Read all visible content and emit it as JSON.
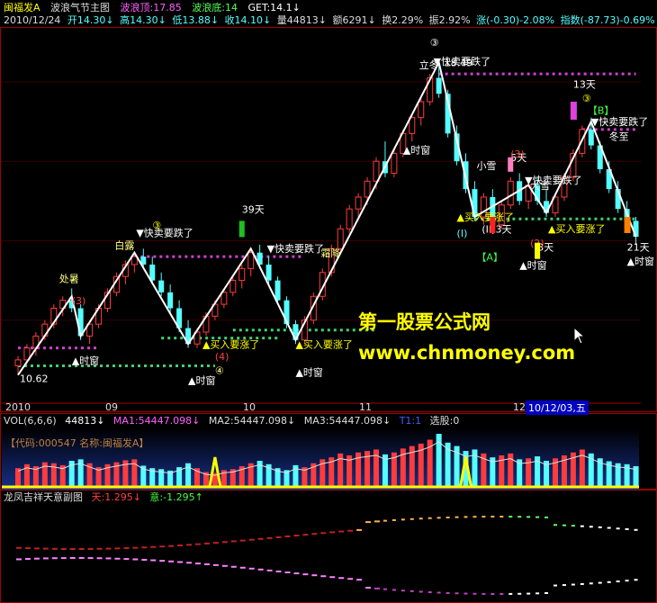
{
  "header": {
    "stock_name": "闽福发A",
    "indicator_name": "波浪气节主图",
    "wave_top_label": "波浪顶:",
    "wave_top_value": "17.85",
    "wave_bottom_label": "波浪底:",
    "wave_bottom_value": "14",
    "get_label": "GET:",
    "get_value": "14.1↓"
  },
  "quote": {
    "date": "2010/12/24",
    "open": "开14.30↓",
    "high": "高14.30↓",
    "low": "低13.88↓",
    "close": "收14.10↓",
    "volume": "量44813↓",
    "amount": "额6291↓",
    "turnover": "换2.29%",
    "amplitude": "振2.92%",
    "change": "涨(-0.30)-2.08%",
    "index": "指数(-87.73)-0.69%"
  },
  "colors": {
    "up": "#ff3c3c",
    "down": "#54ffff",
    "wave": "#ffffff",
    "magenta_dot": "#d040d0",
    "green_dot": "#40d070",
    "yellow": "#ffff00",
    "frame": "#a00000",
    "watermark": "#ffff00"
  },
  "watermark": {
    "title": "第一股票公式网",
    "url": "www.chnmoney.com"
  },
  "x_labels": [
    "2010",
    "09",
    "10",
    "11",
    "12"
  ],
  "date_cursor": "10/12/03,五",
  "chart_data": {
    "type": "candlestick",
    "ylim": [
      10.0,
      19.2
    ],
    "price_high": 18.49,
    "price_low": 10.62,
    "candles": [
      {
        "o": 10.85,
        "h": 11.1,
        "l": 10.62,
        "c": 11.0
      },
      {
        "o": 11.0,
        "h": 11.4,
        "l": 10.9,
        "c": 11.3
      },
      {
        "o": 11.3,
        "h": 11.7,
        "l": 11.1,
        "c": 11.6
      },
      {
        "o": 11.6,
        "h": 12.0,
        "l": 11.5,
        "c": 11.9
      },
      {
        "o": 11.9,
        "h": 12.4,
        "l": 11.8,
        "c": 12.3
      },
      {
        "o": 12.3,
        "h": 12.6,
        "l": 12.1,
        "c": 12.5
      },
      {
        "o": 12.5,
        "h": 12.8,
        "l": 12.2,
        "c": 12.3
      },
      {
        "o": 12.3,
        "h": 12.4,
        "l": 11.5,
        "c": 11.6
      },
      {
        "o": 11.6,
        "h": 12.0,
        "l": 11.4,
        "c": 11.9
      },
      {
        "o": 11.9,
        "h": 12.4,
        "l": 11.8,
        "c": 12.3
      },
      {
        "o": 12.3,
        "h": 12.8,
        "l": 12.2,
        "c": 12.7
      },
      {
        "o": 12.7,
        "h": 13.2,
        "l": 12.6,
        "c": 13.1
      },
      {
        "o": 13.1,
        "h": 13.5,
        "l": 12.9,
        "c": 13.4
      },
      {
        "o": 13.4,
        "h": 13.7,
        "l": 13.2,
        "c": 13.6
      },
      {
        "o": 13.6,
        "h": 13.8,
        "l": 13.3,
        "c": 13.4
      },
      {
        "o": 13.4,
        "h": 13.6,
        "l": 12.9,
        "c": 13.0
      },
      {
        "o": 13.0,
        "h": 13.2,
        "l": 12.6,
        "c": 12.7
      },
      {
        "o": 12.7,
        "h": 12.9,
        "l": 12.2,
        "c": 12.3
      },
      {
        "o": 12.3,
        "h": 12.5,
        "l": 11.7,
        "c": 11.8
      },
      {
        "o": 11.8,
        "h": 12.0,
        "l": 11.3,
        "c": 11.4
      },
      {
        "o": 11.4,
        "h": 11.8,
        "l": 11.3,
        "c": 11.7
      },
      {
        "o": 11.7,
        "h": 12.2,
        "l": 11.6,
        "c": 12.1
      },
      {
        "o": 12.1,
        "h": 12.5,
        "l": 12.0,
        "c": 12.4
      },
      {
        "o": 12.4,
        "h": 12.8,
        "l": 12.3,
        "c": 12.7
      },
      {
        "o": 12.7,
        "h": 13.1,
        "l": 12.6,
        "c": 13.0
      },
      {
        "o": 13.0,
        "h": 13.4,
        "l": 12.8,
        "c": 13.3
      },
      {
        "o": 13.3,
        "h": 13.8,
        "l": 13.1,
        "c": 13.7
      },
      {
        "o": 13.7,
        "h": 13.9,
        "l": 13.3,
        "c": 13.4
      },
      {
        "o": 13.4,
        "h": 13.6,
        "l": 12.9,
        "c": 13.0
      },
      {
        "o": 13.0,
        "h": 13.1,
        "l": 12.4,
        "c": 12.5
      },
      {
        "o": 12.5,
        "h": 12.6,
        "l": 11.8,
        "c": 11.9
      },
      {
        "o": 11.9,
        "h": 12.0,
        "l": 11.4,
        "c": 11.5
      },
      {
        "o": 11.5,
        "h": 12.1,
        "l": 11.4,
        "c": 12.0
      },
      {
        "o": 12.0,
        "h": 12.7,
        "l": 11.9,
        "c": 12.6
      },
      {
        "o": 12.6,
        "h": 13.3,
        "l": 12.5,
        "c": 13.2
      },
      {
        "o": 13.2,
        "h": 13.9,
        "l": 13.1,
        "c": 13.8
      },
      {
        "o": 13.8,
        "h": 14.4,
        "l": 13.7,
        "c": 14.3
      },
      {
        "o": 14.3,
        "h": 14.9,
        "l": 14.2,
        "c": 14.8
      },
      {
        "o": 14.8,
        "h": 15.2,
        "l": 14.5,
        "c": 15.1
      },
      {
        "o": 15.1,
        "h": 15.6,
        "l": 14.9,
        "c": 15.5
      },
      {
        "o": 15.5,
        "h": 16.1,
        "l": 15.3,
        "c": 16.0
      },
      {
        "o": 16.0,
        "h": 16.5,
        "l": 15.6,
        "c": 15.7
      },
      {
        "o": 15.7,
        "h": 16.3,
        "l": 15.6,
        "c": 16.2
      },
      {
        "o": 16.2,
        "h": 16.8,
        "l": 16.1,
        "c": 16.7
      },
      {
        "o": 16.7,
        "h": 17.2,
        "l": 16.5,
        "c": 17.1
      },
      {
        "o": 17.1,
        "h": 17.6,
        "l": 16.9,
        "c": 17.5
      },
      {
        "o": 17.5,
        "h": 18.2,
        "l": 17.4,
        "c": 18.1
      },
      {
        "o": 18.1,
        "h": 18.49,
        "l": 17.6,
        "c": 17.7
      },
      {
        "o": 17.7,
        "h": 17.8,
        "l": 16.6,
        "c": 16.7
      },
      {
        "o": 16.7,
        "h": 16.9,
        "l": 15.9,
        "c": 16.0
      },
      {
        "o": 16.0,
        "h": 16.2,
        "l": 15.2,
        "c": 15.3
      },
      {
        "o": 15.3,
        "h": 15.5,
        "l": 14.5,
        "c": 14.6
      },
      {
        "o": 14.6,
        "h": 15.2,
        "l": 14.4,
        "c": 15.1
      },
      {
        "o": 15.1,
        "h": 15.3,
        "l": 14.3,
        "c": 14.4
      },
      {
        "o": 14.4,
        "h": 15.0,
        "l": 14.3,
        "c": 14.9
      },
      {
        "o": 14.9,
        "h": 15.6,
        "l": 14.8,
        "c": 15.5
      },
      {
        "o": 15.5,
        "h": 15.7,
        "l": 14.9,
        "c": 15.0
      },
      {
        "o": 15.0,
        "h": 15.5,
        "l": 14.8,
        "c": 15.4
      },
      {
        "o": 15.4,
        "h": 15.6,
        "l": 14.9,
        "c": 15.0
      },
      {
        "o": 15.0,
        "h": 15.3,
        "l": 14.6,
        "c": 14.7
      },
      {
        "o": 14.7,
        "h": 15.2,
        "l": 14.6,
        "c": 15.1
      },
      {
        "o": 15.1,
        "h": 15.7,
        "l": 15.0,
        "c": 15.6
      },
      {
        "o": 15.6,
        "h": 16.3,
        "l": 15.5,
        "c": 16.2
      },
      {
        "o": 16.2,
        "h": 16.9,
        "l": 16.1,
        "c": 16.8
      },
      {
        "o": 16.8,
        "h": 17.1,
        "l": 16.3,
        "c": 16.4
      },
      {
        "o": 16.4,
        "h": 16.5,
        "l": 15.7,
        "c": 15.8
      },
      {
        "o": 15.8,
        "h": 16.0,
        "l": 15.2,
        "c": 15.3
      },
      {
        "o": 15.3,
        "h": 15.5,
        "l": 14.7,
        "c": 14.8
      },
      {
        "o": 14.8,
        "h": 15.0,
        "l": 14.3,
        "c": 14.5
      },
      {
        "o": 14.5,
        "h": 14.6,
        "l": 13.9,
        "c": 14.1
      }
    ],
    "wave_line": [
      {
        "i": 0,
        "v": 10.62
      },
      {
        "i": 6,
        "v": 12.6
      },
      {
        "i": 7,
        "v": 11.6
      },
      {
        "i": 13,
        "v": 13.7
      },
      {
        "i": 19,
        "v": 11.4
      },
      {
        "i": 26,
        "v": 13.8
      },
      {
        "i": 31,
        "v": 11.5
      },
      {
        "i": 47,
        "v": 18.49
      },
      {
        "i": 51,
        "v": 14.6
      },
      {
        "i": 54,
        "v": 15.0
      },
      {
        "i": 57,
        "v": 15.4
      },
      {
        "i": 59,
        "v": 14.7
      },
      {
        "i": 64,
        "v": 17.0
      },
      {
        "i": 69,
        "v": 14.1
      }
    ],
    "magenta_levels": [
      {
        "v": 11.3,
        "from": 0,
        "to": 9
      },
      {
        "v": 13.6,
        "from": 13,
        "to": 32
      },
      {
        "v": 18.2,
        "from": 47,
        "to": 69
      },
      {
        "v": 16.8,
        "from": 63,
        "to": 69
      }
    ],
    "green_levels": [
      {
        "v": 10.85,
        "from": 0,
        "to": 22
      },
      {
        "v": 11.55,
        "from": 16,
        "to": 29
      },
      {
        "v": 11.75,
        "from": 24,
        "to": 40
      },
      {
        "v": 14.55,
        "from": 51,
        "to": 69
      }
    ],
    "text_labels": [
      "处暑",
      "白露",
      "③",
      "快卖要跌了",
      "买入要涨了",
      "时窗",
      "39天",
      "霜降",
      "立冬",
      "小雪",
      "大雪",
      "冬至",
      "13天",
      "5天",
      "8天",
      "21天",
      "(I)",
      "(II)3天",
      "(2)",
      "(3)",
      "(4)",
      "④",
      "A",
      "B",
      "18.49",
      "10.62"
    ]
  },
  "volume": {
    "title": "VOL(6,6,6)",
    "value": "44813↓",
    "ma1": "MA1:54447.098↓",
    "ma2": "MA2:54447.098↓",
    "ma3": "MA3:54447.098↓",
    "t1": "T1:1",
    "pick": "选股:0",
    "code_label": "【代码:000547 名称:闽福发A】",
    "values": [
      40,
      48,
      44,
      52,
      50,
      46,
      55,
      58,
      50,
      42,
      48,
      52,
      56,
      58,
      45,
      40,
      38,
      35,
      42,
      50,
      40,
      32,
      30,
      36,
      38,
      44,
      50,
      55,
      48,
      40,
      36,
      46,
      42,
      50,
      58,
      62,
      70,
      66,
      72,
      75,
      78,
      68,
      72,
      80,
      85,
      90,
      98,
      110,
      92,
      85,
      75,
      78,
      70,
      62,
      66,
      70,
      58,
      60,
      64,
      55,
      60,
      66,
      72,
      78,
      70,
      60,
      54,
      50,
      48,
      44
    ]
  },
  "sub": {
    "title": "龙凤吉祥天意副图",
    "tian": "天:1.295↓",
    "yi": "意:-1.295↑"
  }
}
